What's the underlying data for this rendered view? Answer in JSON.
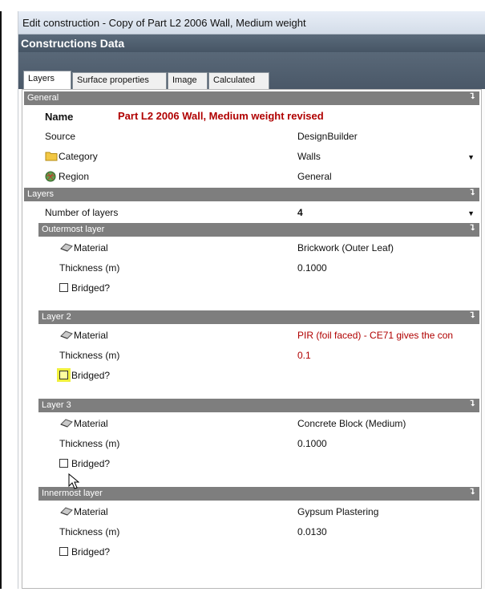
{
  "window": {
    "title": "Edit construction - Copy of Part L2 2006 Wall, Medium weight",
    "header": "Constructions Data"
  },
  "tabs": [
    {
      "label": "Layers",
      "active": true
    },
    {
      "label": "Surface properties",
      "active": false
    },
    {
      "label": "Image",
      "active": false
    },
    {
      "label": "Calculated",
      "active": false
    }
  ],
  "general": {
    "section_label": "General",
    "name_label": "Name",
    "name_value": "Part L2 2006 Wall, Medium weight revised",
    "source_label": "Source",
    "source_value": "DesignBuilder",
    "category_label": "Category",
    "category_value": "Walls",
    "region_label": "Region",
    "region_value": "General"
  },
  "layers": {
    "section_label": "Layers",
    "num_label": "Number of layers",
    "num_value": "4",
    "items": [
      {
        "header": "Outermost layer",
        "material_label": "Material",
        "material_value": "Brickwork (Outer Leaf)",
        "thickness_label": "Thickness (m)",
        "thickness_value": "0.1000",
        "bridged_label": "Bridged?"
      },
      {
        "header": "Layer 2",
        "material_label": "Material",
        "material_value": "PIR (foil faced) - CE71 gives the con",
        "thickness_label": "Thickness (m)",
        "thickness_value": "0.1",
        "bridged_label": "Bridged?"
      },
      {
        "header": "Layer 3",
        "material_label": "Material",
        "material_value": "Concrete Block (Medium)",
        "thickness_label": "Thickness (m)",
        "thickness_value": "0.1000",
        "bridged_label": "Bridged?"
      },
      {
        "header": "Innermost layer",
        "material_label": "Material",
        "material_value": "Gypsum Plastering",
        "thickness_label": "Thickness (m)",
        "thickness_value": "0.0130",
        "bridged_label": "Bridged?"
      }
    ]
  },
  "colors": {
    "section_bg": "#7e7e7e",
    "header_bg": "#4e5d6d",
    "highlight_red": "#b00000",
    "checkbox_highlight": "#f0f03c"
  }
}
